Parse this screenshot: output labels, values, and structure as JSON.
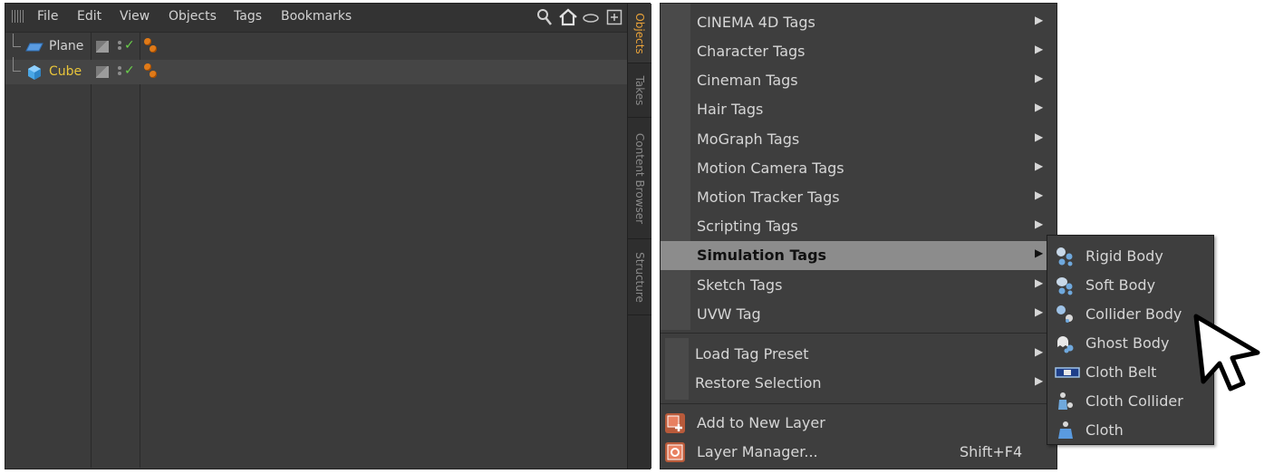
{
  "object_manager": {
    "menu": [
      "File",
      "Edit",
      "View",
      "Objects",
      "Tags",
      "Bookmarks"
    ],
    "toolbar_icons": [
      "search-icon",
      "home-icon",
      "view-icon",
      "new-window-icon"
    ],
    "tabs": [
      {
        "label": "Objects",
        "active": true
      },
      {
        "label": "Takes",
        "active": false
      },
      {
        "label": "Content Browser",
        "active": false
      },
      {
        "label": "Structure",
        "active": false
      }
    ],
    "objects": [
      {
        "name": "Plane",
        "icon": "plane-icon",
        "selected": false,
        "color": "#d2d2d2"
      },
      {
        "name": "Cube",
        "icon": "cube-icon",
        "selected": true,
        "color": "#e8c43a"
      }
    ]
  },
  "context_menu": {
    "items": [
      {
        "label": "CINEMA 4D Tags",
        "submenu": true
      },
      {
        "label": "Character Tags",
        "submenu": true
      },
      {
        "label": "Cineman Tags",
        "submenu": true
      },
      {
        "label": "Hair Tags",
        "submenu": true
      },
      {
        "label": "MoGraph Tags",
        "submenu": true
      },
      {
        "label": "Motion Camera Tags",
        "submenu": true
      },
      {
        "label": "Motion Tracker Tags",
        "submenu": true
      },
      {
        "label": "Scripting Tags",
        "submenu": true
      },
      {
        "label": "Simulation Tags",
        "submenu": true,
        "highlighted": true
      },
      {
        "label": "Sketch Tags",
        "submenu": true
      },
      {
        "label": "UVW Tag",
        "submenu": true
      }
    ],
    "preset_items": [
      {
        "label": "Load Tag Preset",
        "submenu": true
      },
      {
        "label": "Restore Selection",
        "submenu": true
      }
    ],
    "layer_items": [
      {
        "label": "Add to New Layer",
        "icon": "add-layer-icon",
        "shortcut": ""
      },
      {
        "label": "Layer Manager...",
        "icon": "layer-manager-icon",
        "shortcut": "Shift+F4"
      }
    ]
  },
  "simulation_submenu": {
    "items": [
      {
        "label": "Rigid Body",
        "icon": "rigid-body-icon"
      },
      {
        "label": "Soft Body",
        "icon": "soft-body-icon"
      },
      {
        "label": "Collider Body",
        "icon": "collider-body-icon"
      },
      {
        "label": "Ghost Body",
        "icon": "ghost-body-icon"
      },
      {
        "label": "Cloth Belt",
        "icon": "cloth-belt-icon"
      },
      {
        "label": "Cloth Collider",
        "icon": "cloth-collider-icon"
      },
      {
        "label": "Cloth",
        "icon": "cloth-icon"
      }
    ]
  },
  "colors": {
    "panel_bg": "#3b3b3b",
    "menu_highlight": "#8c8c8c",
    "active_tab": "#e8a23a",
    "selected_object": "#e8c43a",
    "check": "#6ad04a"
  }
}
